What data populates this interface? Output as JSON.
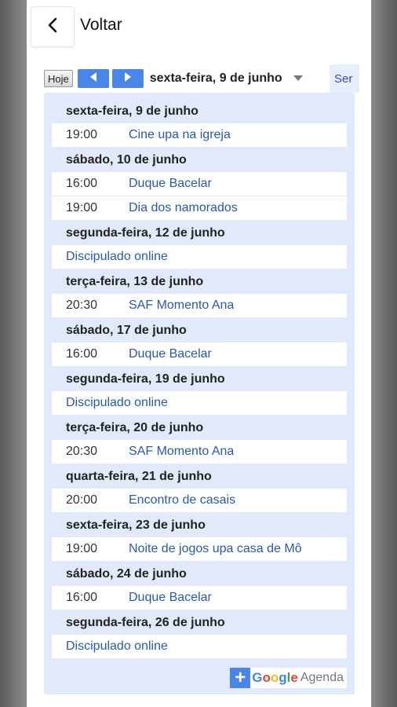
{
  "header": {
    "back_label": "Voltar"
  },
  "toolbar": {
    "today_label": "Hoje",
    "current_date": "sexta-feira, 9 de junho",
    "view_tab_label": "Ser"
  },
  "days": [
    {
      "header": "sexta-feira, 9 de junho",
      "events": [
        {
          "time": "19:00",
          "title": "Cine upa na igreja"
        }
      ]
    },
    {
      "header": "sábado, 10 de junho",
      "events": [
        {
          "time": "16:00",
          "title": "Duque Bacelar"
        },
        {
          "time": "19:00",
          "title": "Dia dos namorados"
        }
      ]
    },
    {
      "header": "segunda-feira, 12 de junho",
      "events": [
        {
          "time": "",
          "title": "Discipulado online"
        }
      ]
    },
    {
      "header": "terça-feira, 13 de junho",
      "events": [
        {
          "time": "20:30",
          "title": "SAF Momento Ana"
        }
      ]
    },
    {
      "header": "sábado, 17 de junho",
      "events": [
        {
          "time": "16:00",
          "title": "Duque Bacelar"
        }
      ]
    },
    {
      "header": "segunda-feira, 19 de junho",
      "events": [
        {
          "time": "",
          "title": "Discipulado online"
        }
      ]
    },
    {
      "header": "terça-feira, 20 de junho",
      "events": [
        {
          "time": "20:30",
          "title": "SAF Momento Ana"
        }
      ]
    },
    {
      "header": "quarta-feira, 21 de junho",
      "events": [
        {
          "time": "20:00",
          "title": "Encontro de casais"
        }
      ]
    },
    {
      "header": "sexta-feira, 23 de junho",
      "events": [
        {
          "time": "19:00",
          "title": "Noite de jogos upa casa de Mô"
        }
      ]
    },
    {
      "header": "sábado, 24 de junho",
      "events": [
        {
          "time": "16:00",
          "title": "Duque Bacelar"
        }
      ]
    },
    {
      "header": "segunda-feira, 26 de junho",
      "events": [
        {
          "time": "",
          "title": "Discipulado online"
        }
      ]
    }
  ],
  "footer": {
    "google_text": "Google",
    "agenda_text": "Agenda"
  },
  "colors": {
    "accent": "#4a86e8",
    "link": "#2857b4",
    "agenda_bg": "#e2e9fb"
  }
}
